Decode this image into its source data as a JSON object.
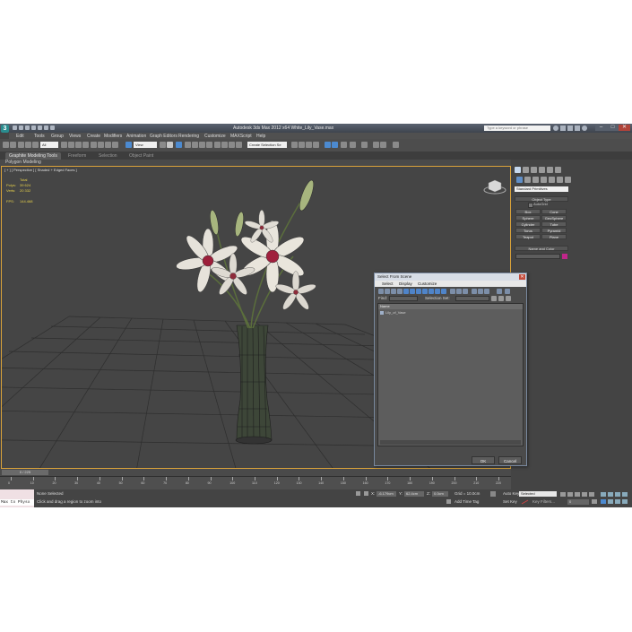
{
  "window": {
    "title": "Autodesk 3ds Max 2012 x64     White_Lily_Vase.max",
    "search_placeholder": "Type a keyword or phrase",
    "minimize": "–",
    "maximize": "□",
    "close": "✕"
  },
  "menu": [
    "Edit",
    "Tools",
    "Group",
    "Views",
    "Create",
    "Modifiers",
    "Animation",
    "Graph Editors",
    "Rendering",
    "Customize",
    "MAXScript",
    "Help"
  ],
  "toolbar": {
    "selection_filter": "All",
    "reference_coord": "View",
    "named_selection": "Create Selection Se"
  },
  "ribbon": {
    "tabs": [
      "Graphite Modeling Tools",
      "Freeform",
      "Selection",
      "Object Paint"
    ],
    "active_tab": 0,
    "sub_label": "Polygon Modeling"
  },
  "viewport": {
    "label": "[ + ] [ Perspective ] [ Shaded + Edged Faces ]",
    "stats": {
      "total_label": "Total",
      "polys_label": "Polys:",
      "polys_value": "39 624",
      "verts_label": "Verts:",
      "verts_value": "20 332",
      "fps_label": "FPS:",
      "fps_value": "144.468"
    }
  },
  "command_panel": {
    "category": "Standard Primitives",
    "object_type_title": "Object Type",
    "autogrid": "AutoGrid",
    "object_buttons": [
      "Box",
      "Cone",
      "Sphere",
      "GeoSphere",
      "Cylinder",
      "Tube",
      "Torus",
      "Pyramid",
      "Teapot",
      "Plane"
    ],
    "name_color_title": "Name and Color",
    "swatch_color": "#c0268a"
  },
  "dialog": {
    "title": "Select From Scene",
    "close": "✕",
    "menu": [
      "Select",
      "Display",
      "Customize"
    ],
    "find_label": "Find:",
    "selection_set_label": "Selection Set:",
    "column_name": "Name",
    "items": [
      "Lily_of_Vase"
    ],
    "ok": "OK",
    "cancel": "Cancel"
  },
  "timeline": {
    "frame": "0 / 225",
    "ticks": [
      "0",
      "10",
      "20",
      "30",
      "40",
      "50",
      "60",
      "70",
      "80",
      "90",
      "100",
      "110",
      "120",
      "130",
      "140",
      "150",
      "160",
      "170",
      "180",
      "190",
      "200",
      "210",
      "220"
    ]
  },
  "status": {
    "script_listener": "Max to Physx",
    "selection": "None Selected",
    "prompt": "Click and drag a region to zoom into",
    "x_label": "X:",
    "x_value": "-6.179cm",
    "y_label": "Y:",
    "y_value": "62.4cm",
    "z_label": "Z:",
    "z_value": "0.0cm",
    "grid": "Grid = 10.0cm",
    "add_time_tag": "Add Time Tag",
    "auto_key": "Auto Key",
    "set_key": "Set Key",
    "key_mode": "Selected",
    "key_filters": "Key Filters...",
    "frame_value": "0"
  }
}
